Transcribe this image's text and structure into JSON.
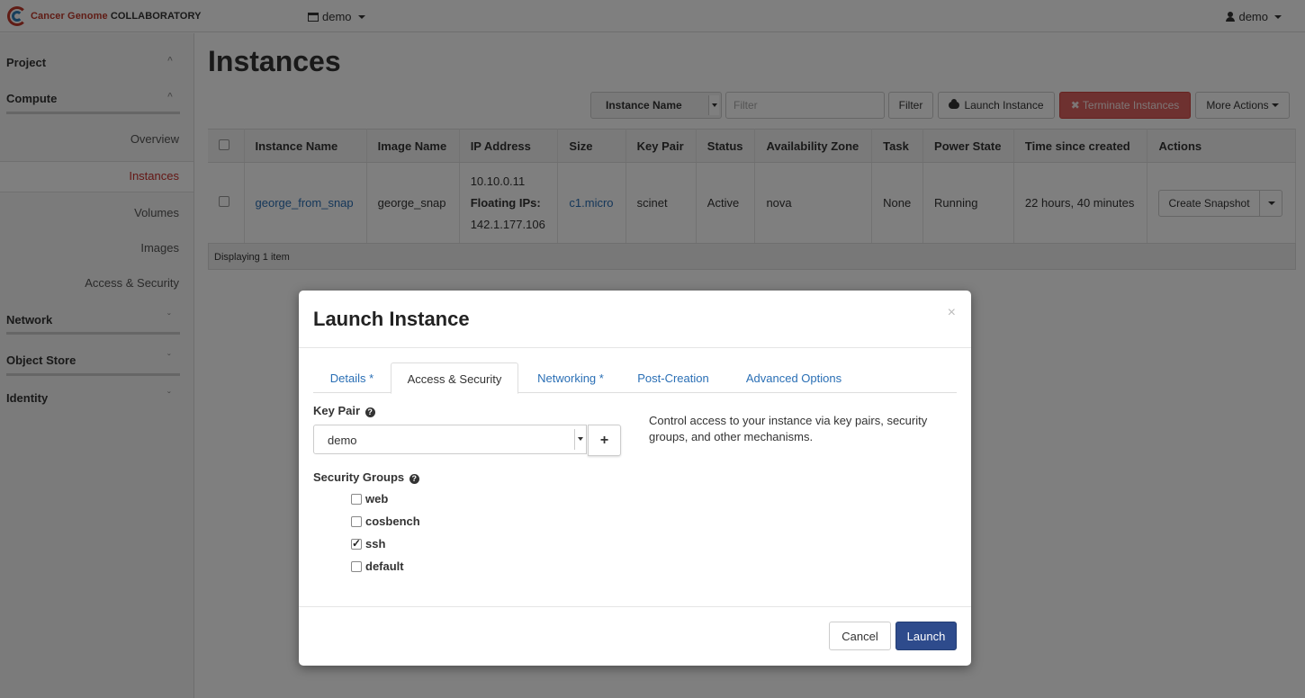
{
  "brand": {
    "part1": "Cancer Genome",
    "part2": "COLLABORATORY"
  },
  "topbar": {
    "project": "demo",
    "user": "demo"
  },
  "sidebar": {
    "project": "Project",
    "compute": "Compute",
    "items": [
      {
        "label": "Overview"
      },
      {
        "label": "Instances"
      },
      {
        "label": "Volumes"
      },
      {
        "label": "Images"
      },
      {
        "label": "Access & Security"
      }
    ],
    "network": "Network",
    "object_store": "Object Store",
    "identity": "Identity",
    "chev_up": "^",
    "chev_down": "ˇ"
  },
  "page": {
    "title": "Instances"
  },
  "toolbar": {
    "filter_field": "Instance Name",
    "filter_placeholder": "Filter",
    "filter_btn": "Filter",
    "launch_btn": "Launch Instance",
    "terminate_btn": "✖ Terminate Instances",
    "more_btn": "More Actions"
  },
  "table": {
    "headers": [
      "Instance Name",
      "Image Name",
      "IP Address",
      "Size",
      "Key Pair",
      "Status",
      "Availability Zone",
      "Task",
      "Power State",
      "Time since created",
      "Actions"
    ],
    "rows": [
      {
        "name": "george_from_snap",
        "image": "george_snap",
        "ip": "10.10.0.11",
        "floating_label": "Floating IPs:",
        "floating_ip": "142.1.177.106",
        "size": "c1.micro",
        "key_pair": "scinet",
        "status": "Active",
        "zone": "nova",
        "task": "None",
        "power": "Running",
        "age": "22 hours, 40 minutes",
        "action": "Create Snapshot"
      }
    ],
    "footer": "Displaying 1 item"
  },
  "modal": {
    "title": "Launch Instance",
    "close": "×",
    "tabs": [
      "Details *",
      "Access & Security",
      "Networking *",
      "Post-Creation",
      "Advanced Options"
    ],
    "active_tab": "Access & Security",
    "key_pair_label": "Key Pair",
    "key_pair_value": "demo",
    "add_symbol": "+",
    "help": "Control access to your instance via key pairs, security groups, and other mechanisms.",
    "security_groups_label": "Security Groups",
    "security_groups": [
      {
        "name": "web",
        "checked": false
      },
      {
        "name": "cosbench",
        "checked": false
      },
      {
        "name": "ssh",
        "checked": true
      },
      {
        "name": "default",
        "checked": false
      }
    ],
    "cancel": "Cancel",
    "launch": "Launch"
  },
  "colors": {
    "accent": "#2e4b8c",
    "danger": "#d9534f",
    "link": "#2a6fb5",
    "active_nav": "#c9302c"
  }
}
